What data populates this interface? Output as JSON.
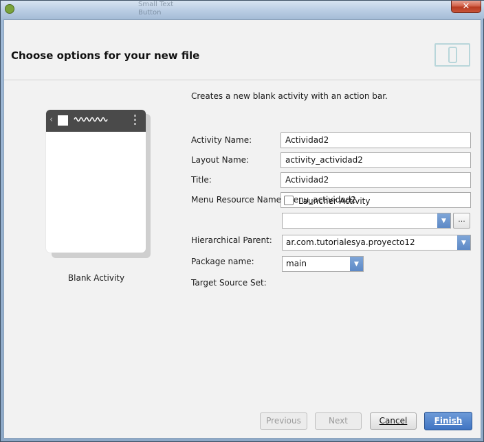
{
  "window": {
    "close_label": "✕",
    "background_labels": [
      "Small Text",
      "Button"
    ]
  },
  "header": {
    "title": "Choose options for your new file"
  },
  "preview": {
    "label": "Blank Activity"
  },
  "form": {
    "description": "Creates a new blank activity with an action bar.",
    "activity_name": {
      "label": "Activity Name:",
      "value": "Actividad2"
    },
    "layout_name": {
      "label": "Layout Name:",
      "value": "activity_actividad2"
    },
    "title": {
      "label": "Title:",
      "value": "Actividad2"
    },
    "menu_resource_name": {
      "label": "Menu Resource Name:",
      "value": "menu_actividad2"
    },
    "launcher_activity": {
      "label": "Launcher Activity",
      "checked": false
    },
    "hierarchical_parent": {
      "label": "Hierarchical Parent:",
      "value": "",
      "browse_label": "..."
    },
    "package_name": {
      "label": "Package name:",
      "value": "ar.com.tutorialesya.proyecto12"
    },
    "target_source_set": {
      "label": "Target Source Set:",
      "value": "main"
    }
  },
  "buttons": {
    "previous": "Previous",
    "next": "Next",
    "cancel": "Cancel",
    "finish": "Finish"
  },
  "colors": {
    "primary_button": "#3f74c2",
    "combo_arrow": "#5d89c6",
    "header_icon": "#b8d6da"
  }
}
